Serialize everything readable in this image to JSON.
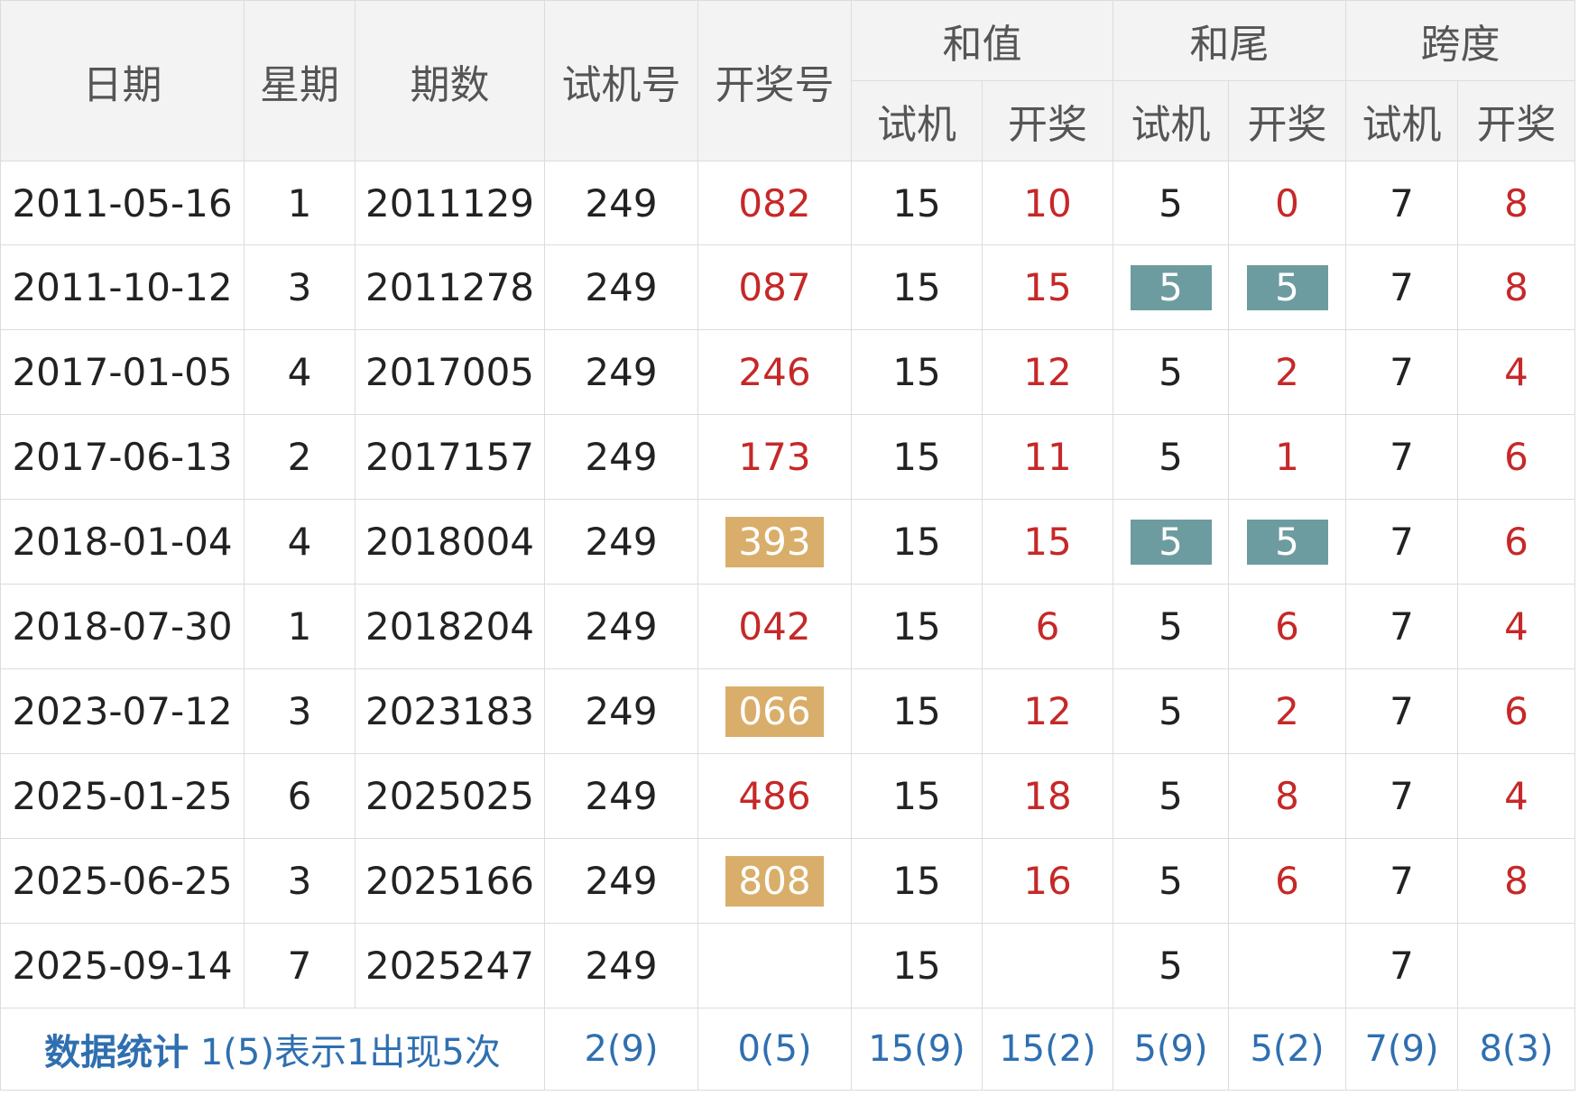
{
  "header": {
    "date": "日期",
    "weekday": "星期",
    "issue": "期数",
    "trial_number": "试机号",
    "draw_number": "开奖号",
    "sum_group": "和值",
    "tail_group": "和尾",
    "span_group": "跨度",
    "sub_trial": "试机",
    "sub_draw": "开奖"
  },
  "rows": [
    {
      "date": "2011-05-16",
      "weekday": "1",
      "issue": "2011129",
      "trial": "249",
      "draw": "082",
      "sum_trial": "15",
      "sum_draw": "10",
      "tail_trial": "5",
      "tail_draw": "0",
      "span_trial": "7",
      "span_draw": "8"
    },
    {
      "date": "2011-10-12",
      "weekday": "3",
      "issue": "2011278",
      "trial": "249",
      "draw": "087",
      "sum_trial": "15",
      "sum_draw": "15",
      "tail_trial": "5",
      "tail_draw": "5",
      "span_trial": "7",
      "span_draw": "8"
    },
    {
      "date": "2017-01-05",
      "weekday": "4",
      "issue": "2017005",
      "trial": "249",
      "draw": "246",
      "sum_trial": "15",
      "sum_draw": "12",
      "tail_trial": "5",
      "tail_draw": "2",
      "span_trial": "7",
      "span_draw": "4"
    },
    {
      "date": "2017-06-13",
      "weekday": "2",
      "issue": "2017157",
      "trial": "249",
      "draw": "173",
      "sum_trial": "15",
      "sum_draw": "11",
      "tail_trial": "5",
      "tail_draw": "1",
      "span_trial": "7",
      "span_draw": "6"
    },
    {
      "date": "2018-01-04",
      "weekday": "4",
      "issue": "2018004",
      "trial": "249",
      "draw": "393",
      "sum_trial": "15",
      "sum_draw": "15",
      "tail_trial": "5",
      "tail_draw": "5",
      "span_trial": "7",
      "span_draw": "6"
    },
    {
      "date": "2018-07-30",
      "weekday": "1",
      "issue": "2018204",
      "trial": "249",
      "draw": "042",
      "sum_trial": "15",
      "sum_draw": "6",
      "tail_trial": "5",
      "tail_draw": "6",
      "span_trial": "7",
      "span_draw": "4"
    },
    {
      "date": "2023-07-12",
      "weekday": "3",
      "issue": "2023183",
      "trial": "249",
      "draw": "066",
      "sum_trial": "15",
      "sum_draw": "12",
      "tail_trial": "5",
      "tail_draw": "2",
      "span_trial": "7",
      "span_draw": "6"
    },
    {
      "date": "2025-01-25",
      "weekday": "6",
      "issue": "2025025",
      "trial": "249",
      "draw": "486",
      "sum_trial": "15",
      "sum_draw": "18",
      "tail_trial": "5",
      "tail_draw": "8",
      "span_trial": "7",
      "span_draw": "4"
    },
    {
      "date": "2025-06-25",
      "weekday": "3",
      "issue": "2025166",
      "trial": "249",
      "draw": "808",
      "sum_trial": "15",
      "sum_draw": "16",
      "tail_trial": "5",
      "tail_draw": "6",
      "span_trial": "7",
      "span_draw": "8"
    },
    {
      "date": "2025-09-14",
      "weekday": "7",
      "issue": "2025247",
      "trial": "249",
      "draw": "",
      "sum_trial": "15",
      "sum_draw": "",
      "tail_trial": "5",
      "tail_draw": "",
      "span_trial": "7",
      "span_draw": ""
    }
  ],
  "stats": {
    "label": "数据统计",
    "note": "1(5)表示1出现5次",
    "trial": "2(9)",
    "draw": "0(5)",
    "sum_trial": "15(9)",
    "sum_draw": "15(2)",
    "tail_trial": "5(9)",
    "tail_draw": "5(2)",
    "span_trial": "7(9)",
    "span_draw": "8(3)"
  },
  "colors": {
    "highlight_draw": "#d9ae6a",
    "highlight_tail": "#6d9ca0",
    "draw_text": "#c62828",
    "stats_text": "#2f6fb0"
  }
}
